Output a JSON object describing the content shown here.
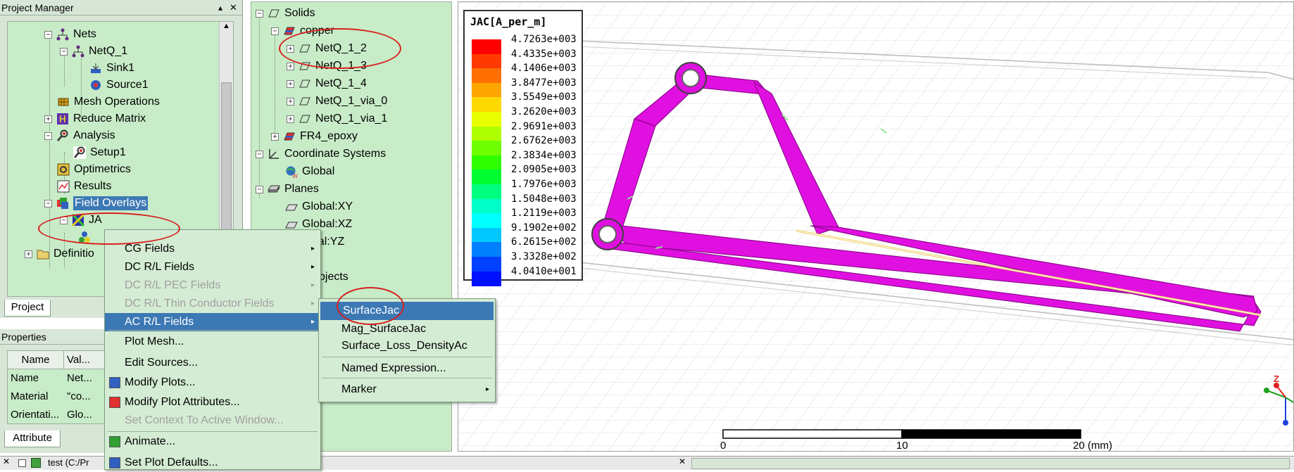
{
  "project_manager": {
    "title": "Project Manager",
    "pin_label": "▴",
    "close_label": "✕",
    "tree": [
      {
        "label": "Nets"
      },
      {
        "label": "NetQ_1"
      },
      {
        "label": "Sink1"
      },
      {
        "label": "Source1"
      },
      {
        "label": "Mesh Operations"
      },
      {
        "label": "Reduce Matrix"
      },
      {
        "label": "Analysis"
      },
      {
        "label": "Setup1"
      },
      {
        "label": "Optimetrics"
      },
      {
        "label": "Results"
      },
      {
        "label": "Field Overlays"
      },
      {
        "label": "JA"
      },
      {
        "label": "Definitio"
      }
    ],
    "tab": "Project"
  },
  "properties": {
    "title": "Properties",
    "columns": [
      "Name",
      "Val..."
    ],
    "rows": [
      [
        "Name",
        "Net..."
      ],
      [
        "Material",
        "\"co..."
      ],
      [
        "Orientati...",
        "Glo..."
      ]
    ],
    "tab": "Attribute"
  },
  "model_tree": {
    "items": [
      {
        "label": "Solids"
      },
      {
        "label": "copper"
      },
      {
        "label": "NetQ_1_2"
      },
      {
        "label": "NetQ_1_3"
      },
      {
        "label": "NetQ_1_4"
      },
      {
        "label": "NetQ_1_via_0"
      },
      {
        "label": "NetQ_1_via_1"
      },
      {
        "label": "FR4_epoxy"
      },
      {
        "label": "Coordinate Systems"
      },
      {
        "label": "Global"
      },
      {
        "label": "Planes"
      },
      {
        "label": "Global:XY"
      },
      {
        "label": "Global:XZ"
      },
      {
        "label": "bal:YZ"
      },
      {
        "label": "bjects"
      }
    ]
  },
  "context_menu": {
    "items": [
      {
        "label": "CG Fields",
        "submenu": true,
        "disabled": false
      },
      {
        "label": "DC R/L Fields",
        "submenu": true,
        "disabled": false
      },
      {
        "label": "DC R/L PEC Fields",
        "submenu": true,
        "disabled": true
      },
      {
        "label": "DC R/L Thin Conductor Fields",
        "submenu": true,
        "disabled": true
      },
      {
        "label": "AC R/L Fields",
        "submenu": true,
        "disabled": false,
        "selected": true
      },
      {
        "label": "Plot Mesh...",
        "disabled": false
      },
      {
        "label": "Edit Sources...",
        "disabled": false
      },
      {
        "label": "Modify Plots...",
        "disabled": false
      },
      {
        "label": "Modify Plot Attributes...",
        "disabled": false
      },
      {
        "label": "Set Context To Active Window...",
        "disabled": true
      },
      {
        "label": "Animate...",
        "disabled": false
      },
      {
        "label": "Set Plot Defaults...",
        "disabled": false
      }
    ]
  },
  "submenu": {
    "items": [
      {
        "label": "SurfaceJac",
        "selected": true
      },
      {
        "label": "Mag_SurfaceJac"
      },
      {
        "label": "Surface_Loss_DensityAc"
      },
      {
        "label": "Named Expression..."
      },
      {
        "label": "Marker",
        "submenu": true
      }
    ]
  },
  "legend": {
    "title": "JAC[A_per_m]",
    "values": [
      "4.7263e+003",
      "4.4335e+003",
      "4.1406e+003",
      "3.8477e+003",
      "3.5549e+003",
      "3.2620e+003",
      "2.9691e+003",
      "2.6762e+003",
      "2.3834e+003",
      "2.0905e+003",
      "1.7976e+003",
      "1.5048e+003",
      "1.2119e+003",
      "9.1902e+002",
      "6.2615e+002",
      "3.3328e+002",
      "4.0410e+001"
    ],
    "colors": [
      "#ff0000",
      "#ff3a00",
      "#ff7000",
      "#ffa500",
      "#ffd800",
      "#e8ff00",
      "#b0ff00",
      "#70ff00",
      "#30ff00",
      "#00ff30",
      "#00ff80",
      "#00ffc8",
      "#00ffff",
      "#00c8ff",
      "#0080ff",
      "#0040ff",
      "#0010ff"
    ]
  },
  "scale": {
    "labels": [
      "0",
      "10",
      "20 (mm)"
    ]
  },
  "axes": {
    "z": "Z",
    "x": "X",
    "y": "Y"
  },
  "bottom": {
    "left_close": "✕",
    "right_close": "✕",
    "status_text": "test (C:/Pr"
  }
}
